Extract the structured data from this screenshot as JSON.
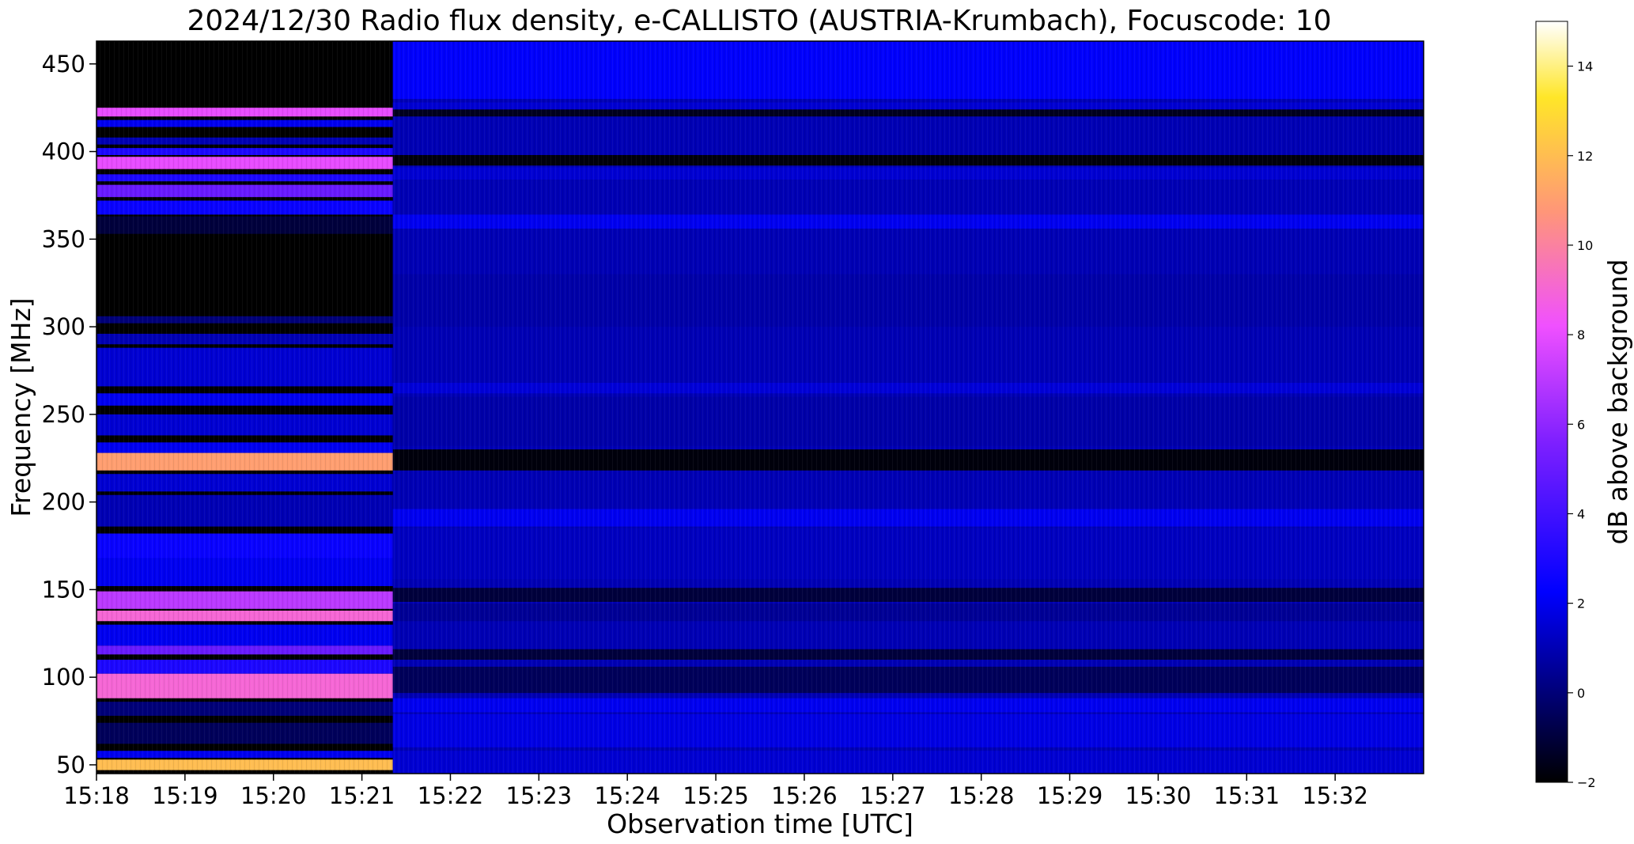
{
  "chart_data": {
    "type": "heatmap",
    "title": "2024/12/30  Radio flux density, e-CALLISTO (AUSTRIA-Krumbach), Focuscode: 10",
    "xlabel": "Observation time [UTC]",
    "ylabel": "Frequency [MHz]",
    "x_tick_labels": [
      "15:18",
      "15:19",
      "15:20",
      "15:21",
      "15:22",
      "15:23",
      "15:24",
      "15:25",
      "15:26",
      "15:27",
      "15:28",
      "15:29",
      "15:30",
      "15:31",
      "15:32"
    ],
    "y_ticks": [
      50,
      100,
      150,
      200,
      250,
      300,
      350,
      400,
      450
    ],
    "xlim_minutes": [
      0,
      15.0
    ],
    "ylim": [
      45,
      463
    ],
    "colorbar": {
      "label": "dB above background",
      "ticks": [
        -2,
        0,
        2,
        4,
        6,
        8,
        10,
        12,
        14
      ],
      "range": [
        -2,
        15
      ],
      "colormap": "gnuplot2"
    },
    "segments": [
      {
        "name": "",
        "t_start": 0.0,
        "t_end": 3.35,
        "background_db": -2,
        "bands": [
          {
            "f": [
              420,
              425
            ],
            "db": 8
          },
          {
            "f": [
              414,
              418
            ],
            "db": 2
          },
          {
            "f": [
              404,
              408
            ],
            "db": 1
          },
          {
            "f": [
              398,
              402
            ],
            "db": 3
          },
          {
            "f": [
              390,
              397
            ],
            "db": 8
          },
          {
            "f": [
              383,
              387
            ],
            "db": 3
          },
          {
            "f": [
              374,
              381
            ],
            "db": 5
          },
          {
            "f": [
              364,
              372
            ],
            "db": 2.5
          },
          {
            "f": [
              353,
              363
            ],
            "db": -1
          },
          {
            "f": [
              302,
              306
            ],
            "db": 0
          },
          {
            "f": [
              290,
              296
            ],
            "db": 1
          },
          {
            "f": [
              266,
              288
            ],
            "db": 1.5
          },
          {
            "f": [
              255,
              262
            ],
            "db": 2
          },
          {
            "f": [
              238,
              250
            ],
            "db": 1.5
          },
          {
            "f": [
              228,
              234
            ],
            "db": 2
          },
          {
            "f": [
              218,
              228
            ],
            "db": 11
          },
          {
            "f": [
              206,
              216
            ],
            "db": 1.5
          },
          {
            "f": [
              186,
              204
            ],
            "db": 1
          },
          {
            "f": [
              168,
              182
            ],
            "db": 2.5
          },
          {
            "f": [
              152,
              168
            ],
            "db": 2
          },
          {
            "f": [
              139,
              149
            ],
            "db": 7
          },
          {
            "f": [
              132,
              138
            ],
            "db": 9
          },
          {
            "f": [
              118,
              130
            ],
            "db": 2
          },
          {
            "f": [
              113,
              118
            ],
            "db": 5
          },
          {
            "f": [
              102,
              110
            ],
            "db": 3
          },
          {
            "f": [
              88,
              102
            ],
            "db": 9
          },
          {
            "f": [
              78,
              86
            ],
            "db": 0
          },
          {
            "f": [
              62,
              74
            ],
            "db": -0.5
          },
          {
            "f": [
              54,
              58
            ],
            "db": 2
          },
          {
            "f": [
              47,
              53
            ],
            "db": 12
          }
        ]
      },
      {
        "name": "",
        "t_start": 3.35,
        "t_end": 15.0,
        "background_db": 1,
        "bands": [
          {
            "f": [
              430,
              463
            ],
            "db": 2.2
          },
          {
            "f": [
              424,
              428
            ],
            "db": 1.5
          },
          {
            "f": [
              420,
              424
            ],
            "db": -1.5
          },
          {
            "f": [
              400,
              419
            ],
            "db": 1
          },
          {
            "f": [
              392,
              398
            ],
            "db": -1.8
          },
          {
            "f": [
              384,
              391
            ],
            "db": 1.5
          },
          {
            "f": [
              376,
              382
            ],
            "db": 1
          },
          {
            "f": [
              356,
              364
            ],
            "db": 2
          },
          {
            "f": [
              330,
              355
            ],
            "db": 1
          },
          {
            "f": [
              300,
              330
            ],
            "db": 0.8
          },
          {
            "f": [
              262,
              268
            ],
            "db": 1.6
          },
          {
            "f": [
              232,
              260
            ],
            "db": 0.8
          },
          {
            "f": [
              218,
              230
            ],
            "db": -1.8
          },
          {
            "f": [
              186,
              196
            ],
            "db": 2
          },
          {
            "f": [
              156,
              185
            ],
            "db": 1.2
          },
          {
            "f": [
              143,
              151
            ],
            "db": -1
          },
          {
            "f": [
              132,
              142
            ],
            "db": 0.5
          },
          {
            "f": [
              117,
              130
            ],
            "db": 1
          },
          {
            "f": [
              110,
              116
            ],
            "db": -1
          },
          {
            "f": [
              91,
              106
            ],
            "db": -0.5
          },
          {
            "f": [
              80,
              88
            ],
            "db": 2
          },
          {
            "f": [
              60,
              79
            ],
            "db": 1.8
          },
          {
            "f": [
              45,
              58
            ],
            "db": 1.5
          }
        ]
      }
    ]
  }
}
